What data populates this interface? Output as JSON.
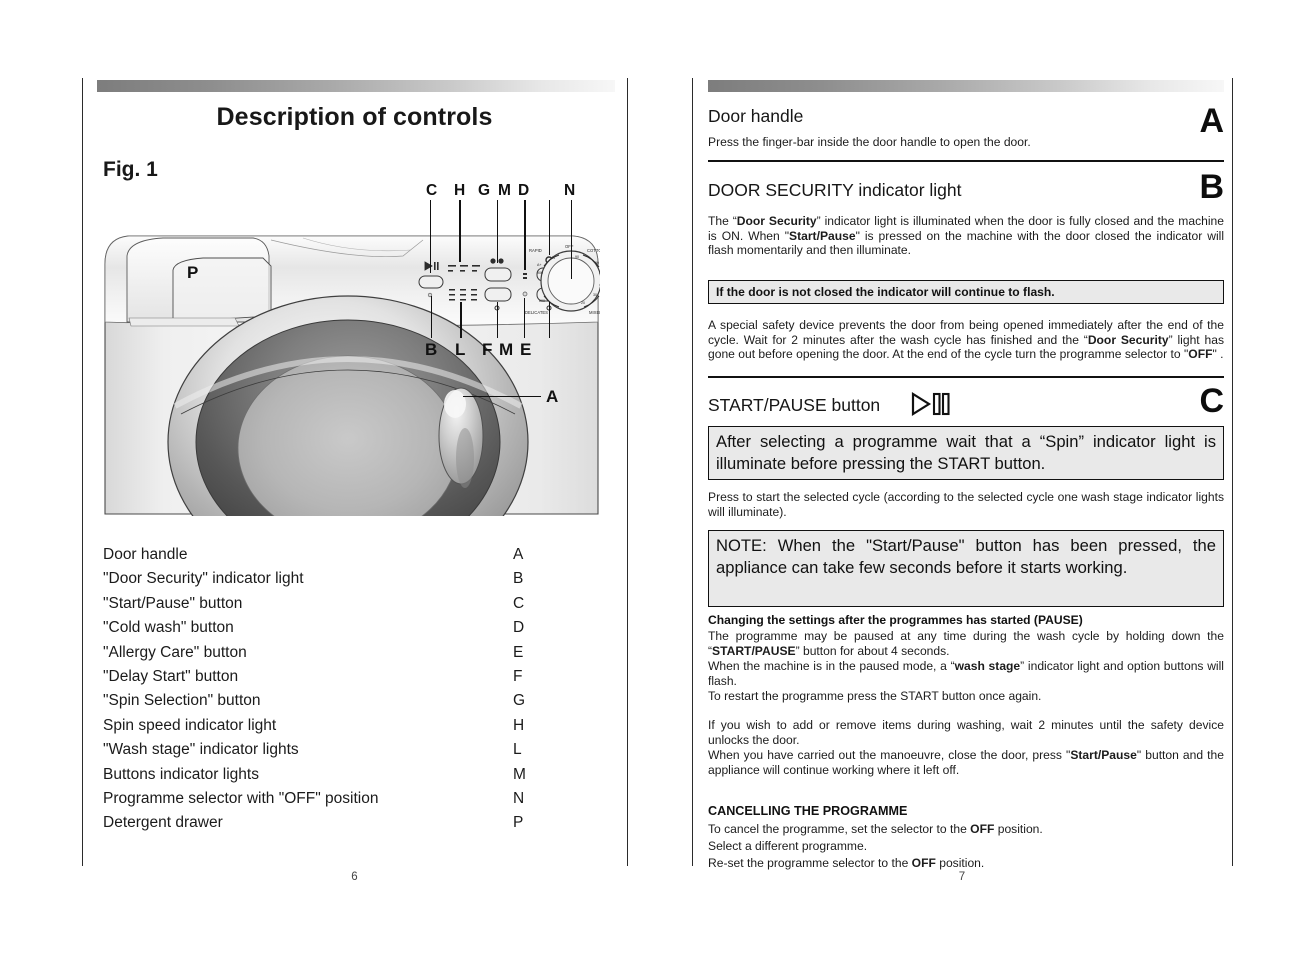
{
  "document": {
    "type": "appliance-user-manual-spread",
    "left_page_number": "6",
    "right_page_number": "7"
  },
  "left_page": {
    "title": "Description of controls",
    "figure_label": "Fig. 1",
    "figure_callouts": [
      {
        "letter": "C",
        "position": "top"
      },
      {
        "letter": "H",
        "position": "top"
      },
      {
        "letter": "G",
        "position": "top"
      },
      {
        "letter": "M",
        "position": "top"
      },
      {
        "letter": "D",
        "position": "top"
      },
      {
        "letter": "N",
        "position": "top"
      },
      {
        "letter": "P",
        "position": "inset-left"
      },
      {
        "letter": "B",
        "position": "bottom"
      },
      {
        "letter": "L",
        "position": "bottom"
      },
      {
        "letter": "F",
        "position": "bottom"
      },
      {
        "letter": "M",
        "position": "bottom"
      },
      {
        "letter": "E",
        "position": "bottom"
      },
      {
        "letter": "A",
        "position": "right"
      }
    ],
    "parts_list": [
      {
        "name": "Door handle",
        "code": "A"
      },
      {
        "name": "\"Door Security\" indicator light",
        "code": "B"
      },
      {
        "name": "\"Start/Pause\" button",
        "code": "C"
      },
      {
        "name": "\"Cold wash\" button",
        "code": "D"
      },
      {
        "name": "\"Allergy Care\" button",
        "code": "E"
      },
      {
        "name": "\"Delay Start\" button",
        "code": "F"
      },
      {
        "name": "\"Spin Selection\" button",
        "code": "G"
      },
      {
        "name": "Spin speed indicator light",
        "code": "H"
      },
      {
        "name": "\"Wash stage\" indicator lights",
        "code": "L"
      },
      {
        "name": "Buttons indicator lights",
        "code": "M"
      },
      {
        "name": "Programme selector with \"OFF\" position",
        "code": "N"
      },
      {
        "name": "Detergent drawer",
        "code": "P"
      }
    ]
  },
  "right_page": {
    "section_a": {
      "heading": "Door handle",
      "letter": "A",
      "body": "Press the finger-bar inside the door handle to open the door."
    },
    "section_b": {
      "heading": "DOOR SECURITY indicator light",
      "letter": "B",
      "para1_part1": "The “",
      "para1_bold1": "Door Security",
      "para1_part2": "” indicator light is illuminated when the door is fully closed and the machine is ON. When \"",
      "para1_bold2": "Start/Pause",
      "para1_part3": "\" is pressed on the machine with the door closed the indicator will flash momentarily and then illuminate.",
      "notice": "If the door is not closed the indicator will continue to flash.",
      "para2_part1": "A special safety device prevents the door from being opened immediately after the end of the cycle. Wait for 2 minutes after the wash cycle has finished and the “",
      "para2_bold1": "Door Security",
      "para2_part2": "” light has gone out before opening the door. At the end of the cycle turn the programme selector to \"",
      "para2_bold2": "OFF",
      "para2_part3": "\" ."
    },
    "section_c": {
      "heading": "START/PAUSE button",
      "letter": "C",
      "icon": "play-pause-icon",
      "highlight": "After selecting a programme wait that a  “Spin” indicator light is illuminate before pressing the START button.",
      "para1": "Press to start the selected cycle (according to the selected cycle one wash stage indicator lights will illuminate).",
      "note": "NOTE: When the \"Start/Pause\" button has been pressed, the appliance can take few seconds before it starts working.",
      "pause_heading": "Changing the settings after the programmes has started (PAUSE)",
      "pause_p1_part1": "The programme may be paused at any time during the wash cycle by holding down the “",
      "pause_p1_bold1": "START/PAUSE",
      "pause_p1_part2": "” button for about 4 seconds.",
      "pause_p2_part1": "When the machine is in the paused mode, a “",
      "pause_p2_bold1": "wash stage",
      "pause_p2_part2": "” indicator light and option buttons will flash.",
      "pause_p3": "To restart the programme press the START button once again.",
      "pause_p4": "If you wish to add or remove items during washing, wait 2 minutes until the safety device unlocks the door.",
      "pause_p5_part1": "When you have carried out the manoeuvre, close the door, press \"",
      "pause_p5_bold1": "Start/Pause",
      "pause_p5_part2": "\" button and the appliance will continue working where it left off.",
      "cancel_heading": "CANCELLING THE PROGRAMME",
      "cancel_l1_part1": "To cancel the programme, set the selector to the ",
      "cancel_l1_bold1": "OFF",
      "cancel_l1_part2": " position.",
      "cancel_l2": "Select a different programme.",
      "cancel_l3_part1": "Re-set the programme selector to the ",
      "cancel_l3_bold1": "OFF",
      "cancel_l3_part2": " position."
    }
  },
  "colors": {
    "text": "#1a1a1a",
    "rule": "#111111",
    "callbox_bg": "#e9e9e9",
    "gradient_start": "#7d7d7d",
    "gradient_end": "#f7f7f7"
  }
}
